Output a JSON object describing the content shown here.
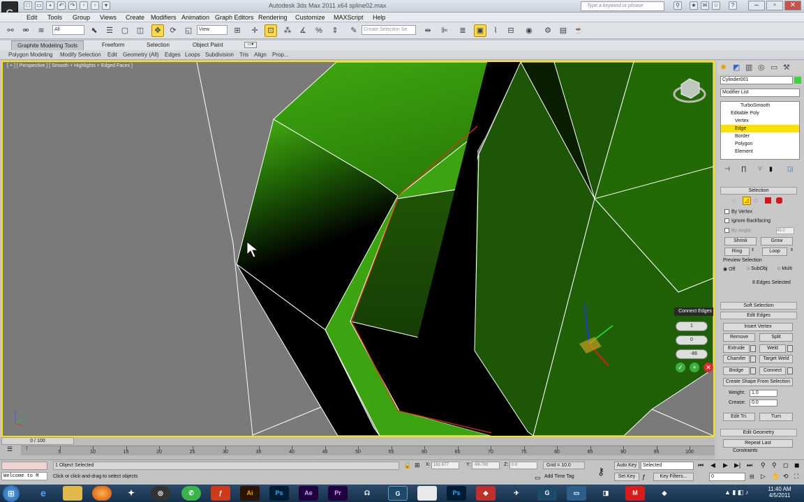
{
  "app": {
    "title": "Autodesk 3ds Max 2011 x64     spline02.max",
    "search_placeholder": "Type a keyword or phrase",
    "logo_glyph": "G"
  },
  "menu": [
    "Edit",
    "Tools",
    "Group",
    "Views",
    "Create",
    "Modifiers",
    "Animation",
    "Graph Editors",
    "Rendering",
    "Customize",
    "MAXScript",
    "Help"
  ],
  "toolbar": {
    "selection_filter": "All",
    "ref_coord": "View",
    "named_selection_placeholder": "Create Selection Se"
  },
  "ribbon": {
    "tabs": [
      "Graphite Modeling Tools",
      "Freeform",
      "Selection",
      "Object Paint"
    ],
    "panels": [
      "Polygon Modeling",
      "Modify Selection",
      "Edit",
      "Geometry (All)",
      "Edges",
      "Loops",
      "Subdivision",
      "Tris",
      "Align",
      "Prop..."
    ]
  },
  "viewport": {
    "label": "[ + ] [ Perspective ] [ Smooth + Highlights + Edged Faces ]",
    "accent_color": "#ffe200"
  },
  "caddy": {
    "title": "Connect Edges",
    "segments": "1",
    "pinch": "0",
    "slide": "-86"
  },
  "command_panel": {
    "object_name": "Cylinder001",
    "object_color": "#3fd13f",
    "modifier_list": "Modifier List",
    "stack": [
      "TurboSmooth",
      "Editable Poly",
      "Vertex",
      "Edge",
      "Border",
      "Polygon",
      "Element"
    ],
    "selection": {
      "title": "Selection",
      "by_vertex": "By Vertex",
      "ignore_backfacing": "Ignore Backfacing",
      "by_angle": "By Angle:",
      "by_angle_value": "45.0",
      "shrink": "Shrink",
      "grow": "Grow",
      "ring": "Ring",
      "loop": "Loop",
      "preview_selection": "Preview Selection",
      "preview_options": [
        "Off",
        "SubObj",
        "Multi"
      ],
      "status": "8 Edges Selected"
    },
    "soft_selection": "Soft Selection",
    "edit_edges": {
      "title": "Edit Edges",
      "insert_vertex": "Insert Vertex",
      "remove": "Remove",
      "split": "Split",
      "extrude": "Extrude",
      "weld": "Weld",
      "chamfer": "Chamfer",
      "target_weld": "Target Weld",
      "bridge": "Bridge",
      "connect": "Connect",
      "create_shape": "Create Shape From Selection",
      "weight_label": "Weight:",
      "weight_value": "1.0",
      "crease_label": "Crease:",
      "crease_value": "0.0",
      "edit_tri": "Edit Tri.",
      "turn": "Turn"
    },
    "edit_geometry": {
      "title": "Edit Geometry",
      "repeat_last": "Repeat Last",
      "constraints": "Constraints"
    }
  },
  "timeline": {
    "counter": "0 / 100",
    "ticks": [
      "0",
      "5",
      "10",
      "15",
      "20",
      "25",
      "30",
      "35",
      "40",
      "45",
      "50",
      "55",
      "60",
      "65",
      "70",
      "75",
      "80",
      "85",
      "90",
      "95",
      "100"
    ]
  },
  "status": {
    "selected": "1 Object Selected",
    "prompt": "Click or click-and-drag to select objects",
    "maxscript": "Welcome to M",
    "x_label": "X:",
    "x_value": "181.677",
    "y_label": "Y:",
    "y_value": "-69.793",
    "z_label": "Z:",
    "z_value": "0.0",
    "grid": "Grid = 10.0",
    "add_time_tag": "Add Time Tag",
    "auto_key": "Auto Key",
    "set_key": "Set Key",
    "key_mode": "Selected",
    "key_filters": "Key Filters...",
    "frame": "0"
  },
  "taskbar": {
    "time": "11:40 AM",
    "date": "4/5/2011",
    "apps": [
      "Ai",
      "Ps",
      "Ae",
      "Pr",
      "Ps"
    ]
  }
}
